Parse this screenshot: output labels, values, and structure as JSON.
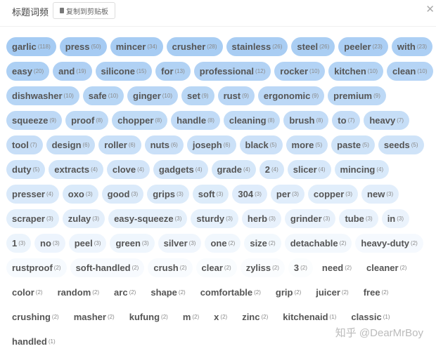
{
  "header": {
    "title": "标题词频",
    "copy_label": "复制到剪贴板",
    "copy_icon": "clipboard-icon",
    "close_icon": "close-icon",
    "close_glyph": "✕"
  },
  "accent_color": "#b3d4f5",
  "tags": [
    [
      "garlic",
      118
    ],
    [
      "press",
      50
    ],
    [
      "mincer",
      34
    ],
    [
      "crusher",
      28
    ],
    [
      "stainless",
      26
    ],
    [
      "steel",
      26
    ],
    [
      "peeler",
      23
    ],
    [
      "with",
      23
    ],
    [
      "easy",
      20
    ],
    [
      "and",
      19
    ],
    [
      "silicone",
      15
    ],
    [
      "for",
      13
    ],
    [
      "professional",
      12
    ],
    [
      "rocker",
      10
    ],
    [
      "kitchen",
      10
    ],
    [
      "clean",
      10
    ],
    [
      "dishwasher",
      10
    ],
    [
      "safe",
      10
    ],
    [
      "ginger",
      10
    ],
    [
      "set",
      9
    ],
    [
      "rust",
      9
    ],
    [
      "ergonomic",
      9
    ],
    [
      "premium",
      9
    ],
    [
      "squeeze",
      9
    ],
    [
      "proof",
      8
    ],
    [
      "chopper",
      8
    ],
    [
      "handle",
      8
    ],
    [
      "cleaning",
      8
    ],
    [
      "brush",
      8
    ],
    [
      "to",
      7
    ],
    [
      "heavy",
      7
    ],
    [
      "tool",
      7
    ],
    [
      "design",
      6
    ],
    [
      "roller",
      6
    ],
    [
      "nuts",
      6
    ],
    [
      "joseph",
      6
    ],
    [
      "black",
      5
    ],
    [
      "more",
      5
    ],
    [
      "paste",
      5
    ],
    [
      "seeds",
      5
    ],
    [
      "duty",
      5
    ],
    [
      "extracts",
      4
    ],
    [
      "clove",
      4
    ],
    [
      "gadgets",
      4
    ],
    [
      "grade",
      4
    ],
    [
      "2",
      4
    ],
    [
      "slicer",
      4
    ],
    [
      "mincing",
      4
    ],
    [
      "presser",
      4
    ],
    [
      "oxo",
      3
    ],
    [
      "good",
      3
    ],
    [
      "grips",
      3
    ],
    [
      "soft",
      3
    ],
    [
      "304",
      3
    ],
    [
      "per",
      3
    ],
    [
      "copper",
      3
    ],
    [
      "new",
      3
    ],
    [
      "scraper",
      3
    ],
    [
      "zulay",
      3
    ],
    [
      "easy-squeeze",
      3
    ],
    [
      "sturdy",
      3
    ],
    [
      "herb",
      3
    ],
    [
      "grinder",
      3
    ],
    [
      "tube",
      3
    ],
    [
      "in",
      3
    ],
    [
      "1",
      3
    ],
    [
      "no",
      3
    ],
    [
      "peel",
      3
    ],
    [
      "green",
      3
    ],
    [
      "silver",
      3
    ],
    [
      "one",
      2
    ],
    [
      "size",
      2
    ],
    [
      "detachable",
      2
    ],
    [
      "heavy-duty",
      2
    ],
    [
      "rustproof",
      2
    ],
    [
      "soft-handled",
      2
    ],
    [
      "crush",
      2
    ],
    [
      "clear",
      2
    ],
    [
      "zyliss",
      2
    ],
    [
      "3",
      2
    ],
    [
      "need",
      2
    ],
    [
      "cleaner",
      2
    ],
    [
      "color",
      2
    ],
    [
      "random",
      2
    ],
    [
      "arc",
      2
    ],
    [
      "shape",
      2
    ],
    [
      "comfortable",
      2
    ],
    [
      "grip",
      2
    ],
    [
      "juicer",
      2
    ],
    [
      "free",
      2
    ],
    [
      "crushing",
      2
    ],
    [
      "masher",
      2
    ],
    [
      "kufung",
      2
    ],
    [
      "m",
      2
    ],
    [
      "x",
      2
    ],
    [
      "zinc",
      2
    ],
    [
      "kitchenaid",
      1
    ],
    [
      "classic",
      1
    ],
    [
      "handled",
      1
    ]
  ],
  "watermark": "知乎 @DearMrBoy"
}
